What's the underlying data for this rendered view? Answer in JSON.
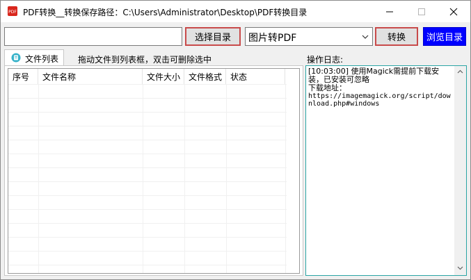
{
  "window": {
    "title": "PDF转换__转换保存路径：C:\\Users\\Administrator\\Desktop\\PDF转换目录"
  },
  "toolbar": {
    "path_value": "",
    "select_dir_label": "选择目录",
    "mode_value": "图片转PDF",
    "convert_label": "转换",
    "browse_label": "浏览目录"
  },
  "tabs": {
    "file_list_label": "文件列表"
  },
  "hint": "拖动文件到列表框，双击可删除选中",
  "log": {
    "title": "操作日志:",
    "line1": "[10:03:00] 使用Magick需提前下载安装，已安装可忽略",
    "line2": "下载地址：",
    "line3": "https://imagemagick.org/script/download.php#windows"
  },
  "table": {
    "columns": [
      "序号",
      "文件名称",
      "文件大小",
      "文件格式",
      "状态"
    ]
  },
  "colors": {
    "accent_red": "#c84a4a",
    "browse_blue": "#0000ff",
    "log_border": "#2aa5a5"
  },
  "icons": {
    "app": "pdf-app-icon",
    "tab": "file-list-icon",
    "dropdown": "chevron-down-icon"
  }
}
